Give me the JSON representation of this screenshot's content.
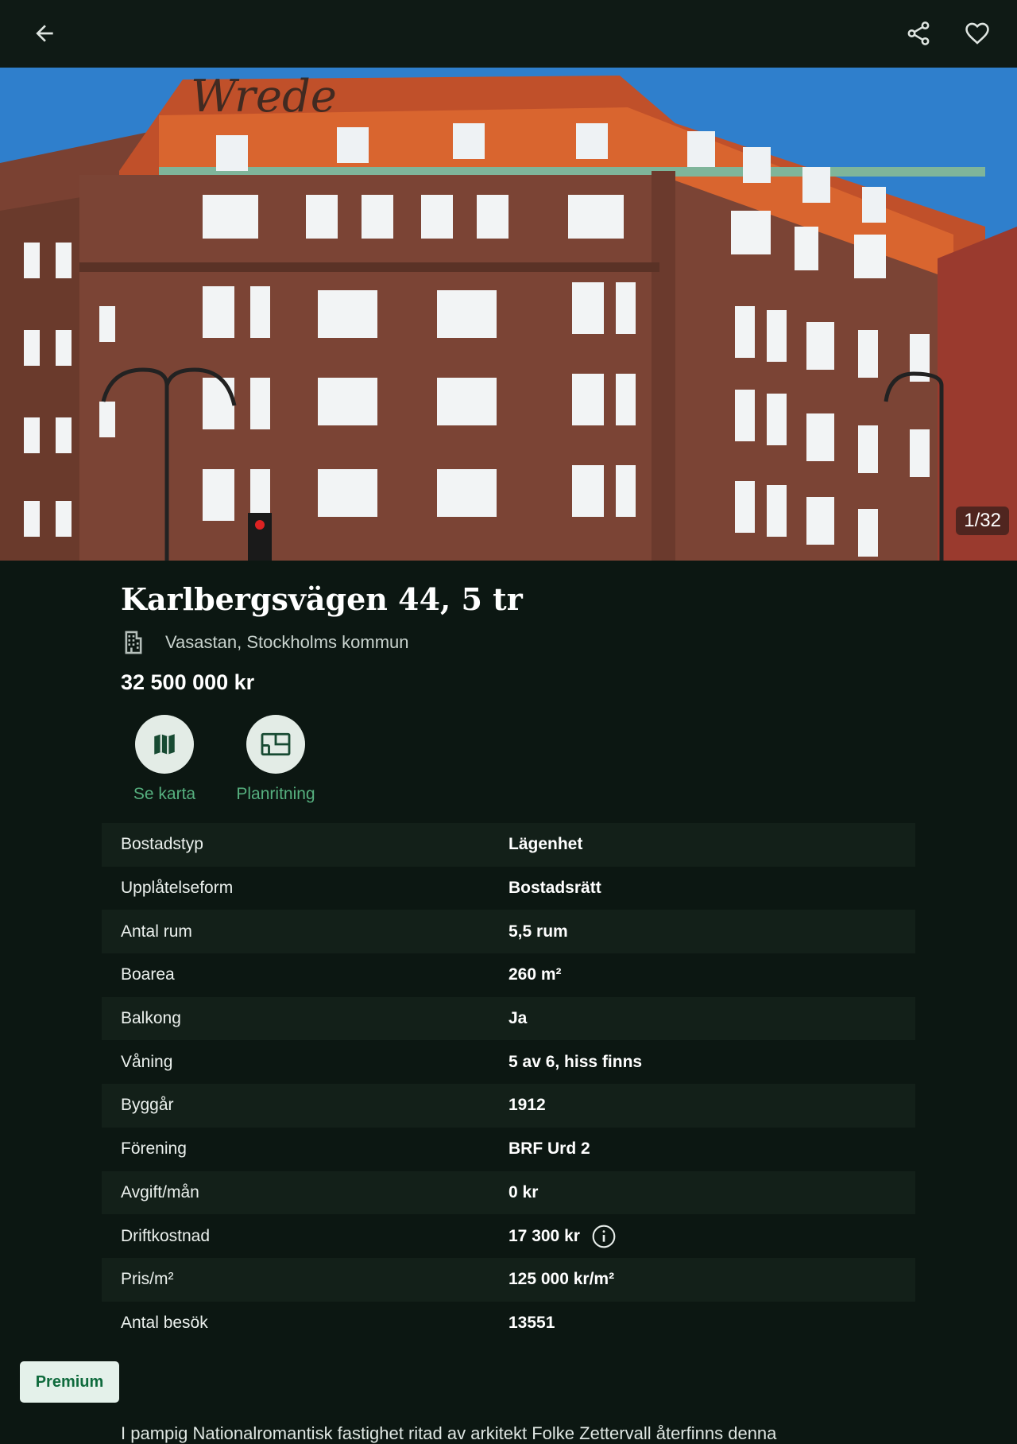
{
  "header": {
    "back_icon": "arrow-left-icon",
    "share_icon": "share-icon",
    "favorite_icon": "heart-outline-icon"
  },
  "gallery": {
    "counter": "1/32",
    "watermark": "Wrede"
  },
  "listing": {
    "title": "Karlbergsvägen 44, 5 tr",
    "area": "Vasastan, Stockholms kommun",
    "area_icon": "building-icon",
    "price": "32 500 000 kr"
  },
  "actions": [
    {
      "label": "Se karta",
      "icon": "map-icon"
    },
    {
      "label": "Planritning",
      "icon": "floorplan-icon"
    }
  ],
  "facts": [
    {
      "key": "Bostadstyp",
      "value": "Lägenhet"
    },
    {
      "key": "Upplåtelseform",
      "value": "Bostadsrätt"
    },
    {
      "key": "Antal rum",
      "value": "5,5 rum"
    },
    {
      "key": "Boarea",
      "value": "260 m²"
    },
    {
      "key": "Balkong",
      "value": "Ja"
    },
    {
      "key": "Våning",
      "value": "5 av 6, hiss finns"
    },
    {
      "key": "Byggår",
      "value": "1912"
    },
    {
      "key": "Förening",
      "value": "BRF Urd 2"
    },
    {
      "key": "Avgift/mån",
      "value": "0 kr"
    },
    {
      "key": "Driftkostnad",
      "value": "17 300 kr"
    },
    {
      "key": "Pris/m²",
      "value": "125 000 kr/m²"
    },
    {
      "key": "Antal besök",
      "value": "13551"
    }
  ],
  "premium_label": "Premium",
  "description": "I pampig Nationalromantisk fastighet ritad av arkitekt Folke Zettervall återfinns denna",
  "colors": {
    "background": "#0c1712",
    "accent": "#56b07f",
    "row_alt": "#132019"
  }
}
